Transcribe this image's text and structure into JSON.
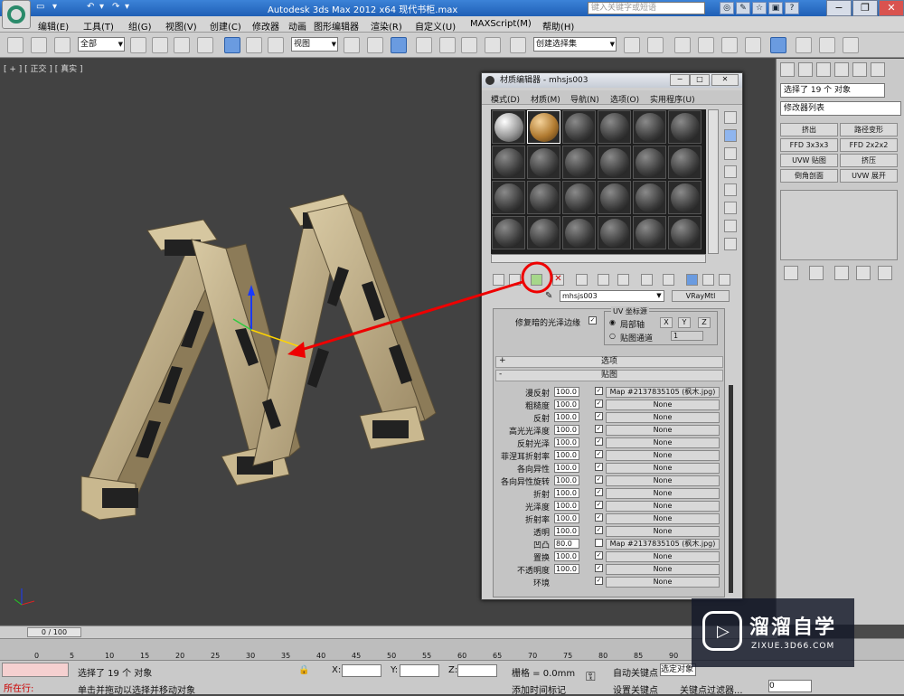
{
  "titlebar": {
    "app_title": "Autodesk 3ds Max  2012 x64     现代书柜.max",
    "search_placeholder": "键入关键字或短语",
    "quick_access": [
      "▭",
      "▾",
      "↶",
      "▾",
      "↷",
      "▾"
    ]
  },
  "menubar": [
    "编辑(E)",
    "工具(T)",
    "组(G)",
    "视图(V)",
    "创建(C)",
    "修改器",
    "动画",
    "图形编辑器",
    "渲染(R)",
    "自定义(U)",
    "MAXScript(M)",
    "帮助(H)"
  ],
  "toolbar": {
    "filter": "全部",
    "ref_coord": "视图",
    "named_selection": "创建选择集"
  },
  "viewport": {
    "label": "[ + ] [ 正交 ] [ 真实 ]"
  },
  "command_panel": {
    "selection": "选择了 19 个 对象",
    "modifier_list": "修改器列表",
    "modifier_buttons": [
      "挤出",
      "路径变形",
      "FFD 3x3x3",
      "FFD 2x2x2",
      "UVW 贴图",
      "挤压",
      "倒角剖面",
      "UVW 展开"
    ]
  },
  "material_editor": {
    "title": "材质编辑器 - mhsjs003",
    "menu": [
      "模式(D)",
      "材质(M)",
      "导航(N)",
      "选项(O)",
      "实用程序(U)"
    ],
    "material_name": "mhsjs003",
    "material_type": "VRayMtl",
    "uv_group_label": "UV 坐标源",
    "fix_dark_edges": "修复暗的光泽边缘",
    "local_axis": "局部轴",
    "map_channel": "贴图通道",
    "channel_value": "1",
    "axes": [
      "X",
      "Y",
      "Z"
    ],
    "rollout_options": "选项",
    "rollout_maps": "贴图",
    "maps": [
      {
        "label": "漫反射",
        "amount": "100.0",
        "checked": true,
        "map": "Map #2137835105 (枫木.jpg)"
      },
      {
        "label": "粗糙度",
        "amount": "100.0",
        "checked": true,
        "map": "None"
      },
      {
        "label": "反射",
        "amount": "100.0",
        "checked": true,
        "map": "None"
      },
      {
        "label": "高光光泽度",
        "amount": "100.0",
        "checked": true,
        "map": "None"
      },
      {
        "label": "反射光泽",
        "amount": "100.0",
        "checked": true,
        "map": "None"
      },
      {
        "label": "菲涅耳折射率",
        "amount": "100.0",
        "checked": true,
        "map": "None"
      },
      {
        "label": "各向异性",
        "amount": "100.0",
        "checked": true,
        "map": "None"
      },
      {
        "label": "各向异性旋转",
        "amount": "100.0",
        "checked": true,
        "map": "None"
      },
      {
        "label": "折射",
        "amount": "100.0",
        "checked": true,
        "map": "None"
      },
      {
        "label": "光泽度",
        "amount": "100.0",
        "checked": true,
        "map": "None"
      },
      {
        "label": "折射率",
        "amount": "100.0",
        "checked": true,
        "map": "None"
      },
      {
        "label": "透明",
        "amount": "100.0",
        "checked": true,
        "map": "None"
      },
      {
        "label": "凹凸",
        "amount": "80.0",
        "checked": false,
        "map": "Map #2137835105 (枫木.jpg)"
      },
      {
        "label": "置换",
        "amount": "100.0",
        "checked": true,
        "map": "None"
      },
      {
        "label": "不透明度",
        "amount": "100.0",
        "checked": true,
        "map": "None"
      },
      {
        "label": "环境",
        "amount": "",
        "checked": true,
        "map": "None"
      }
    ]
  },
  "timeline": {
    "frame": "0 / 100",
    "ticks": [
      "0",
      "5",
      "10",
      "15",
      "20",
      "25",
      "30",
      "35",
      "40",
      "45",
      "50",
      "55",
      "60",
      "65",
      "70",
      "75",
      "80",
      "85",
      "90"
    ]
  },
  "status": {
    "in_progress": "所在行:",
    "selected": "选择了 19 个 对象",
    "hint": "单击并拖动以选择并移动对象",
    "x_label": "X:",
    "y_label": "Y:",
    "z_label": "Z:",
    "grid": "栅格 = 0.0mm",
    "add_time_tag": "添加时间标记",
    "auto_key": "自动关键点",
    "set_key": "设置关键点",
    "selected_object": "选定对象",
    "key_filters": "关键点过滤器...",
    "frame_value": "0"
  },
  "watermark": {
    "name": "溜溜自学",
    "url": "ZIXUE.3D66.COM"
  }
}
